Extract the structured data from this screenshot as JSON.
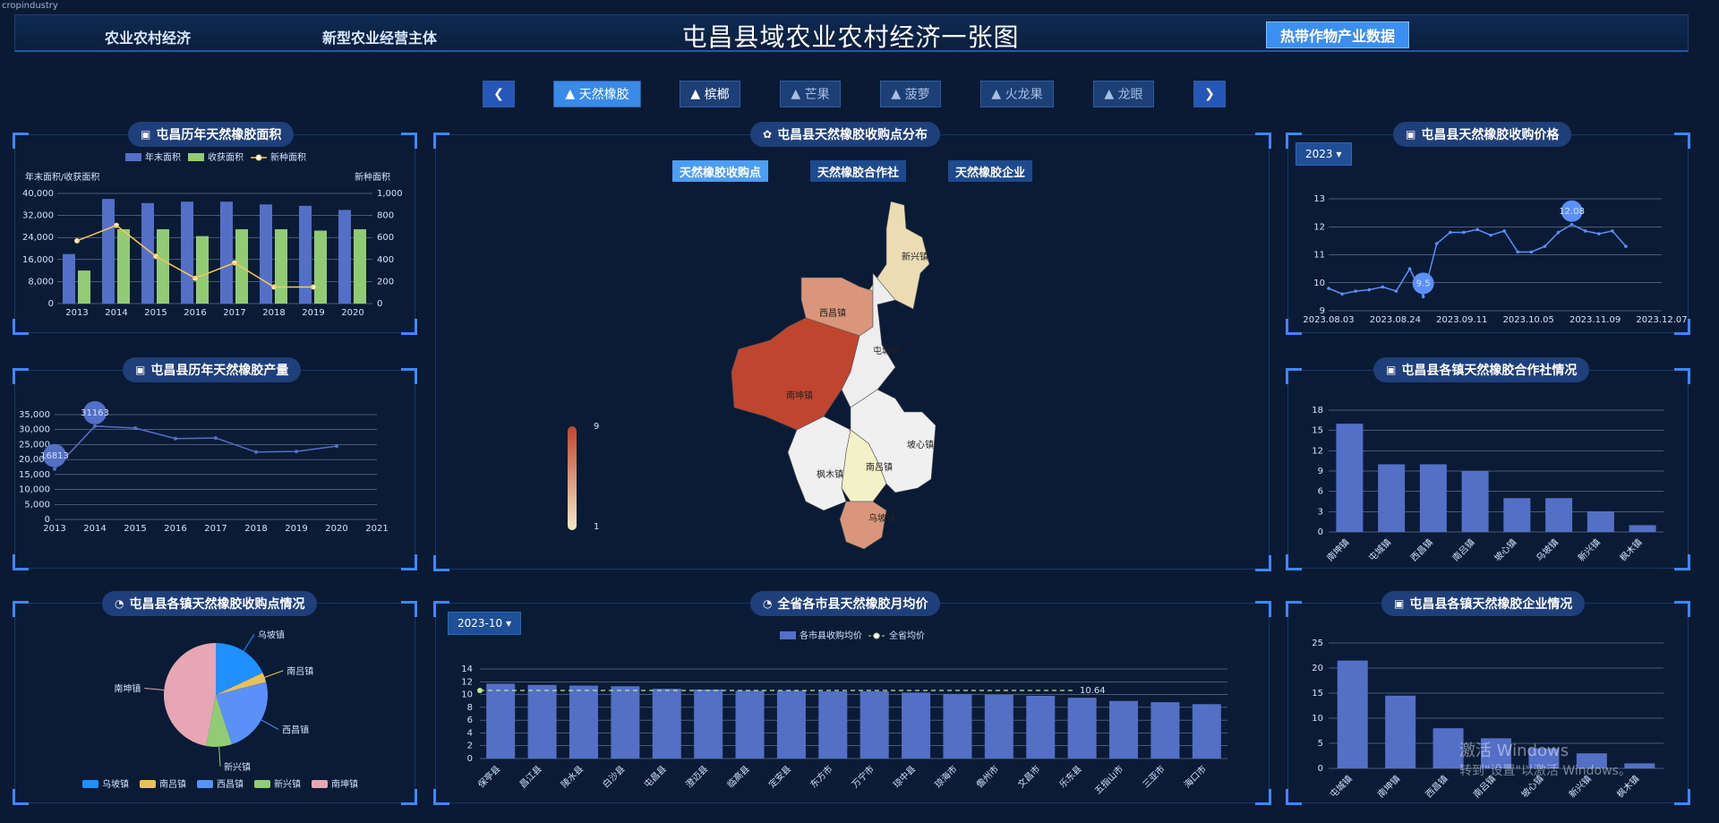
{
  "app_label": "cropindustry",
  "header": {
    "left_tabs": [
      "农业农村经济",
      "新型农业经营主体"
    ],
    "title": "屯昌县域农业农村经济一张图",
    "right_button": "热带作物产业数据"
  },
  "crop_tabs": [
    "天然橡胶",
    "槟榔",
    "芒果",
    "菠萝",
    "火龙果",
    "龙眼"
  ],
  "panels": {
    "area": {
      "title": "屯昌历年天然橡胶面积",
      "legend": [
        "年末面积",
        "收获面积",
        "新种面积"
      ],
      "ylabel_left": "年末面积/收获面积",
      "ylabel_right": "新种面积"
    },
    "output": {
      "title": "屯昌县历年天然橡胶产量"
    },
    "points": {
      "title": "屯昌县各镇天然橡胶收购点情况"
    },
    "map": {
      "title": "屯昌县天然橡胶收购点分布",
      "buttons": [
        "天然橡胶收购点",
        "天然橡胶合作社",
        "天然橡胶企业"
      ],
      "scale_max": "9",
      "scale_min": "1"
    },
    "monthly": {
      "title": "全省各市县天然橡胶月均价",
      "dropdown": "2023-10",
      "legend": [
        "各市县收购均价",
        "全省均价"
      ]
    },
    "price": {
      "title": "屯昌县天然橡胶收购价格",
      "dropdown": "2023"
    },
    "coop": {
      "title": "屯昌县各镇天然橡胶合作社情况"
    },
    "ent": {
      "title": "屯昌县各镇天然橡胶企业情况"
    }
  },
  "map_towns": [
    "新兴镇",
    "西昌镇",
    "屯城镇",
    "南坤镇",
    "坡心镇",
    "枫木镇",
    "南吕镇",
    "乌坡镇"
  ],
  "watermark": [
    "激活 Windows",
    "转到\"设置\"以激活 Windows。"
  ],
  "chart_data": [
    {
      "id": "area",
      "type": "bar",
      "categories": [
        "2013",
        "2014",
        "2015",
        "2016",
        "2017",
        "2018",
        "2019",
        "2020"
      ],
      "series": [
        {
          "name": "年末面积",
          "values": [
            18000,
            38000,
            36500,
            37000,
            37000,
            36000,
            35500,
            34000
          ]
        },
        {
          "name": "收获面积",
          "values": [
            12000,
            27000,
            27000,
            24500,
            27000,
            27000,
            26500,
            27000
          ]
        },
        {
          "name": "新种面积",
          "type": "line",
          "axis": "right",
          "values": [
            570,
            710,
            430,
            230,
            370,
            150,
            150,
            null
          ]
        }
      ],
      "ylim": [
        0,
        40000
      ],
      "yticks": [
        "0",
        "8,000",
        "16,000",
        "24,000",
        "32,000",
        "40,000"
      ],
      "y2lim": [
        0,
        1000
      ],
      "y2ticks": [
        "0",
        "200",
        "400",
        "600",
        "800",
        "1,000"
      ]
    },
    {
      "id": "output",
      "type": "line",
      "categories": [
        "2013",
        "2014",
        "2015",
        "2016",
        "2017",
        "2018",
        "2019",
        "2020",
        "2021"
      ],
      "values": [
        16813,
        31163,
        30500,
        27000,
        27200,
        22500,
        22700,
        24500,
        null
      ],
      "ylim": [
        0,
        35000
      ],
      "yticks": [
        "0",
        "5,000",
        "10,000",
        "15,000",
        "20,000",
        "25,000",
        "30,000",
        "35,000"
      ],
      "labels": [
        "16813",
        "31163"
      ]
    },
    {
      "id": "points",
      "type": "pie",
      "slices": [
        {
          "name": "乌坡镇",
          "value": 18
        },
        {
          "name": "南吕镇",
          "value": 3
        },
        {
          "name": "西昌镇",
          "value": 24
        },
        {
          "name": "新兴镇",
          "value": 8
        },
        {
          "name": "南坤镇",
          "value": 47
        }
      ]
    },
    {
      "id": "price",
      "type": "line",
      "x_labels": [
        "2023.08.03",
        "2023.08.24",
        "2023.09.11",
        "2023.10.05",
        "2023.11.09",
        "2023.12.07"
      ],
      "values": [
        9.8,
        9.6,
        9.7,
        9.75,
        9.85,
        9.7,
        10.5,
        9.5,
        11.4,
        11.8,
        11.8,
        11.9,
        11.7,
        11.85,
        11.1,
        11.1,
        11.3,
        11.8,
        12.08,
        11.85,
        11.75,
        11.85,
        11.3
      ],
      "ylim": [
        9,
        13
      ],
      "yticks": [
        "9",
        "10",
        "11",
        "12",
        "13"
      ],
      "labels": [
        "9.5",
        "12.08"
      ]
    },
    {
      "id": "coop",
      "type": "bar",
      "categories": [
        "南坤镇",
        "屯城镇",
        "西昌镇",
        "南吕镇",
        "坡心镇",
        "乌坡镇",
        "新兴镇",
        "枫木镇"
      ],
      "values": [
        16,
        10,
        10,
        9,
        5,
        5,
        3,
        1
      ],
      "ylim": [
        0,
        18
      ],
      "yticks": [
        "0",
        "3",
        "6",
        "9",
        "12",
        "15",
        "18"
      ]
    },
    {
      "id": "ent",
      "type": "bar",
      "categories": [
        "屯城镇",
        "南坤镇",
        "西昌镇",
        "南吕镇",
        "坡心镇",
        "新兴镇",
        "枫木镇"
      ],
      "values": [
        21.5,
        14.5,
        8,
        6,
        4,
        3,
        1
      ],
      "ylim": [
        0,
        25
      ],
      "yticks": [
        "0",
        "5",
        "10",
        "15",
        "20",
        "25"
      ]
    },
    {
      "id": "monthly",
      "type": "bar",
      "categories": [
        "保亭县",
        "昌江县",
        "陵水县",
        "白沙县",
        "屯昌县",
        "澄迈县",
        "临高县",
        "定安县",
        "东方市",
        "万宁市",
        "琼中县",
        "琼海市",
        "儋州市",
        "文昌市",
        "乐东县",
        "五指山市",
        "三亚市",
        "海口市"
      ],
      "values": [
        11.7,
        11.5,
        11.4,
        11.3,
        10.9,
        10.8,
        10.6,
        10.6,
        10.5,
        10.5,
        10.3,
        10.1,
        10.0,
        9.8,
        9.5,
        9.0,
        8.8,
        8.5
      ],
      "average": 10.64,
      "average_label": "10.64",
      "ylim": [
        0,
        14
      ],
      "yticks": [
        "0",
        "2",
        "4",
        "6",
        "8",
        "10",
        "12",
        "14"
      ]
    }
  ]
}
